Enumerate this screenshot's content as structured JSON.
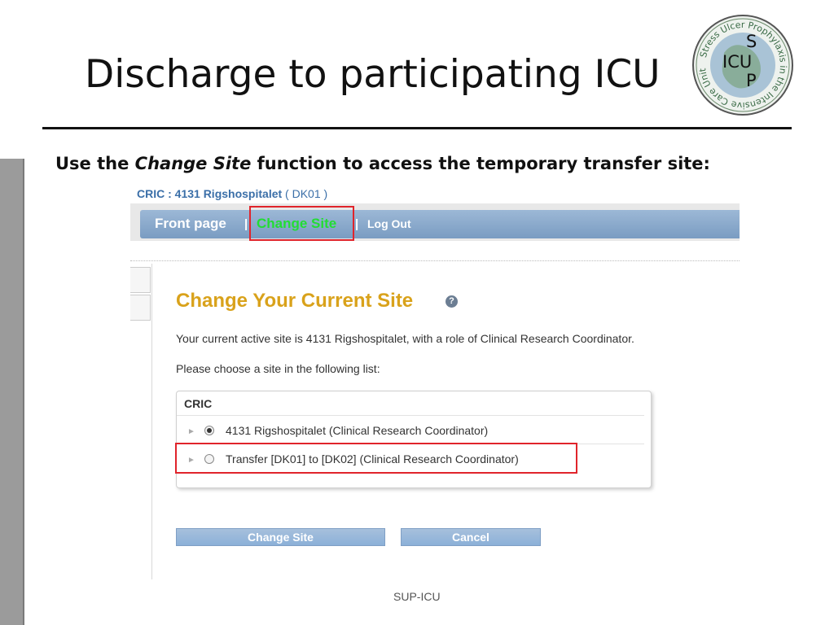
{
  "slide": {
    "title": "Discharge to participating ICU",
    "intro_prefix": "Use the ",
    "intro_emphasis": "Change Site",
    "intro_suffix": " function to access the temporary transfer site:",
    "footer": "SUP-ICU"
  },
  "logo": {
    "ring_text": "Stress Ulcer Prophylaxis in the Intensive Care Unit",
    "letters": [
      "S",
      "ICU",
      "P"
    ]
  },
  "app": {
    "breadcrumb": {
      "label": "CRIC : 4131 Rigshospitalet",
      "code": "( DK01 )"
    },
    "nav": {
      "front_page": "Front page",
      "separator": "|",
      "change_site": "Change Site",
      "log_out": "Log Out"
    },
    "page_heading": "Change Your Current Site",
    "help_icon": "?",
    "current_site_text": "Your current active site is 4131 Rigshospitalet, with a role of Clinical Research Coordinator.",
    "choose_text": "Please choose a site in the following list:",
    "site_list": {
      "header": "CRIC",
      "rows": [
        {
          "label": "4131 Rigshospitalet (Clinical Research Coordinator)",
          "selected": true
        },
        {
          "label": "Transfer [DK01] to [DK02] (Clinical Research Coordinator)",
          "selected": false
        }
      ]
    },
    "buttons": {
      "change_site": "Change Site",
      "cancel": "Cancel"
    }
  },
  "colors": {
    "highlight_box": "#e0242b",
    "active_nav": "#22dd33",
    "heading": "#d9a21b",
    "nav_bar": "#8aaad0"
  }
}
